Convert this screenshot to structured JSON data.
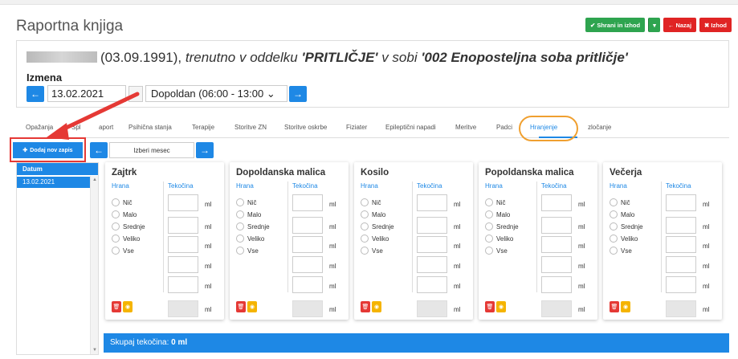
{
  "page": {
    "title": "Raportna knjiga"
  },
  "header_buttons": {
    "save_exit": "✔ Shrani in izhod",
    "back": "← Nazaj",
    "exit": "✖ Izhod"
  },
  "patient": {
    "birthdate": "(03.09.1991),",
    "text_location": " trenutno v oddelku ",
    "department": "'PRITLIČJE'",
    "text_room": " v sobi ",
    "room": "'002 Enoposteljna soba pritličje'"
  },
  "shift": {
    "label": "Izmena",
    "date": "13.02.2021",
    "selected": "Dopoldan (06:00 - 13:00"
  },
  "tabs": [
    {
      "label": "Opažanja"
    },
    {
      "label": "Spl"
    },
    {
      "label": "aport"
    },
    {
      "label": "Psihična stanja"
    },
    {
      "label": "Terapije"
    },
    {
      "label": "Storitve ZN"
    },
    {
      "label": "Storitve oskrbe"
    },
    {
      "label": "Fiziater"
    },
    {
      "label": "Epileptični napadi"
    },
    {
      "label": "Meritve"
    },
    {
      "label": "Padci"
    },
    {
      "label": "Hranjenje"
    },
    {
      "label": "zločanje"
    }
  ],
  "active_tab": "Hranjenje",
  "add_button": "Dodaj nov zapis",
  "month_picker": {
    "placeholder": "Izberi mesec"
  },
  "dates_table": {
    "header": "Datum",
    "rows": [
      "13.02.2021"
    ]
  },
  "meals": [
    {
      "title": "Zajtrk"
    },
    {
      "title": "Dopoldanska malica"
    },
    {
      "title": "Kosilo"
    },
    {
      "title": "Popoldanska malica"
    },
    {
      "title": "Večerja"
    }
  ],
  "meal_labels": {
    "food": "Hrana",
    "liquid": "Tekočina",
    "unit": "ml",
    "food_options": [
      "Nič",
      "Malo",
      "Srednje",
      "Veliko",
      "Vse"
    ]
  },
  "summary": {
    "label": "Skupaj tekočina:",
    "value": "0 ml"
  },
  "colors": {
    "primary": "#1e88e5",
    "success": "#2ea44f",
    "danger": "#e02424",
    "warning": "#f5b400",
    "highlight_orange": "#f0a030",
    "annotation_red": "#e53935"
  }
}
